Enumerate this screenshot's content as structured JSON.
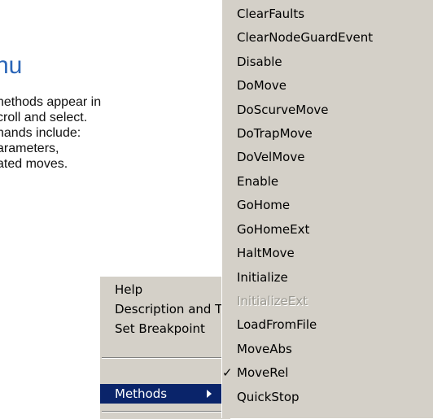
{
  "slide": {
    "title": "nu",
    "body_lines": [
      "nethods appear in",
      "croll and select.",
      "nands include:",
      "arameters,",
      "ated moves."
    ]
  },
  "context_menu": {
    "items": [
      "Help",
      "Description and Tip...",
      "Set Breakpoint"
    ],
    "methods_label": "Methods"
  },
  "methods_submenu": {
    "checked_item": "MoveRel",
    "disabled_item": "InitializeExt",
    "items": [
      "ClearFaults",
      "ClearNodeGuardEvent",
      "Disable",
      "DoMove",
      "DoScurveMove",
      "DoTrapMove",
      "DoVelMove",
      "Enable",
      "GoHome",
      "GoHomeExt",
      "HaltMove",
      "Initialize",
      "InitializeExt",
      "LoadFromFile",
      "MoveAbs",
      "MoveRel",
      "QuickStop"
    ],
    "check_mark": "✓"
  },
  "colors": {
    "menu_bg": "#d4d0c8",
    "highlight": "#0a246a",
    "title_blue": "#2b66b8",
    "disabled_text": "#9a9890"
  }
}
